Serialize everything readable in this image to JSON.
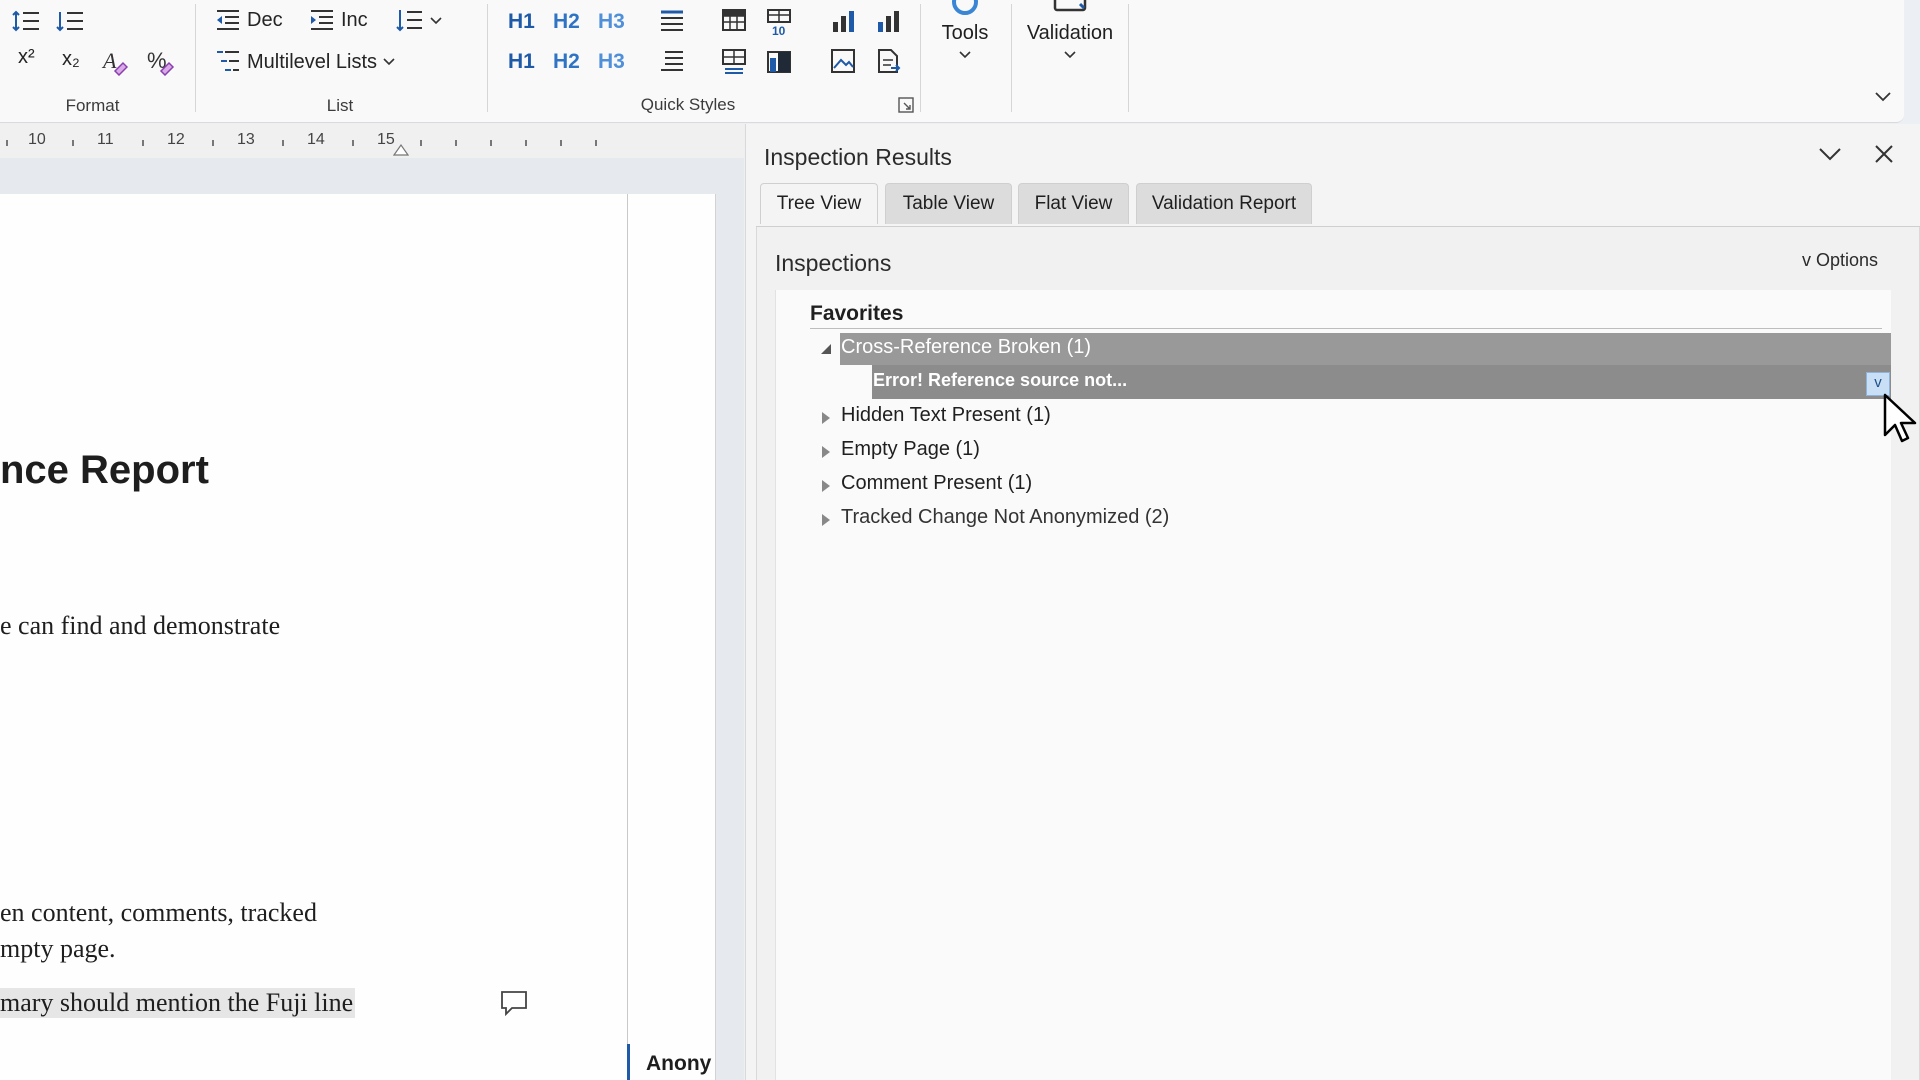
{
  "ribbon": {
    "format_label": "Format",
    "list_label": "List",
    "quick_styles_label": "Quick Styles",
    "dec_label": "Dec",
    "inc_label": "Inc",
    "multilevel_label": "Multilevel Lists",
    "tools_label": "Tools",
    "validation_label": "Validation",
    "superscript_glyph": "x²",
    "subscript_glyph": "x₂",
    "headings": [
      "H1",
      "H2",
      "H3"
    ]
  },
  "ruler": {
    "numbers": [
      "10",
      "11",
      "12",
      "13",
      "14",
      "15"
    ]
  },
  "document": {
    "title_fragment": "nce Report",
    "line1": "e can find and demonstrate",
    "line2": "en content, comments, tracked",
    "line3": "mpty page.",
    "line4": "mary should mention the Fuji line",
    "margin_comment_author": "Anony"
  },
  "panel": {
    "title": "Inspection Results",
    "tabs": [
      {
        "label": "Tree View",
        "active": true
      },
      {
        "label": "Table View",
        "active": false
      },
      {
        "label": "Flat View",
        "active": false
      },
      {
        "label": "Validation Report",
        "active": false
      }
    ],
    "section_title": "Inspections",
    "options_label": "v Options",
    "group_title": "Favorites",
    "items": [
      {
        "label": "Cross-Reference Broken (1)",
        "expanded": true,
        "selected": true
      },
      {
        "label": "Hidden Text Present (1)",
        "expanded": false
      },
      {
        "label": "Empty Page (1)",
        "expanded": false
      },
      {
        "label": "Comment Present (1)",
        "expanded": false
      },
      {
        "label": "Tracked Change Not Anonymized (2)",
        "expanded": false
      }
    ],
    "child_item": {
      "label": "Error! Reference source not...",
      "dropdown_glyph": "v"
    }
  },
  "colors": {
    "selection_bg": "#999999",
    "child_selection_bg": "#8c8c8c",
    "dropdown_bg": "#c9dff5",
    "accent_blue": "#1e5aa8"
  }
}
